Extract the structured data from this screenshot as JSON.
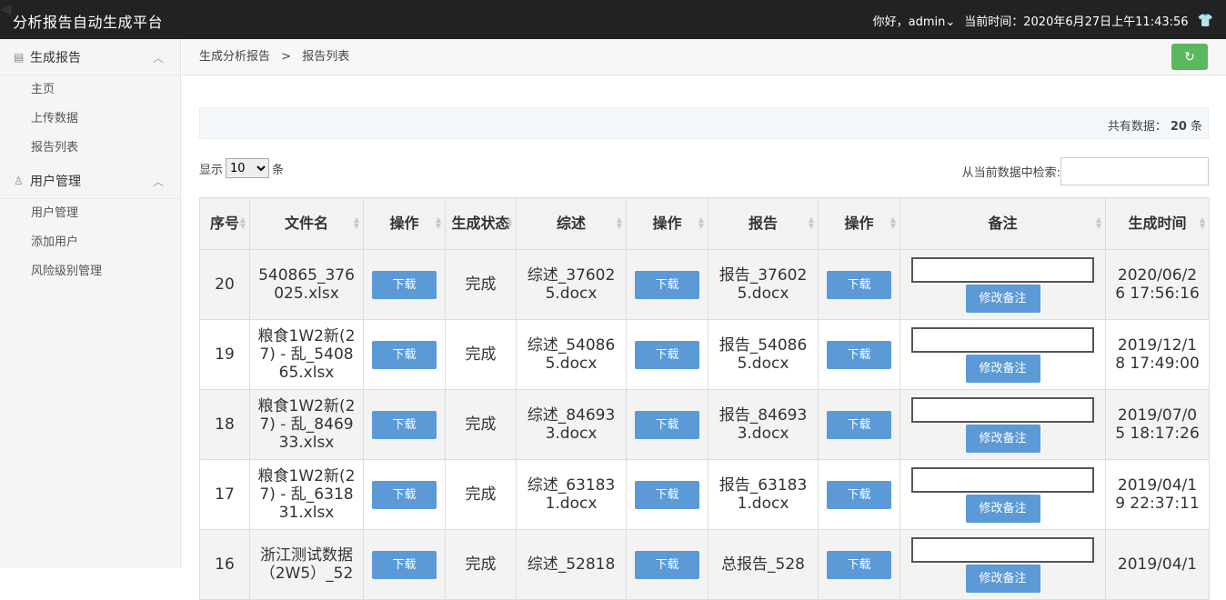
{
  "header": {
    "title": "分析报告自动生成平台",
    "greeting": "你好，admin",
    "current_time": "当前时间：2020年6月27日上午11:43:56"
  },
  "sidebar": {
    "groups": [
      {
        "label": "生成报告",
        "items": [
          "主页",
          "上传数据",
          "报告列表"
        ]
      },
      {
        "label": "用户管理",
        "items": [
          "用户管理",
          "添加用户",
          "风险级别管理"
        ]
      }
    ]
  },
  "breadcrumb": {
    "parent": "生成分析报告",
    "sep": ">",
    "current": "报告列表"
  },
  "summary": {
    "label": "共有数据：",
    "count": "20",
    "unit": "条"
  },
  "length_control": {
    "prefix": "显示",
    "value": "10",
    "suffix": "条"
  },
  "search": {
    "label": "从当前数据中检索:"
  },
  "table": {
    "headers": [
      "序号",
      "文件名",
      "操作",
      "生成状态",
      "综述",
      "操作",
      "报告",
      "操作",
      "备注",
      "生成时间"
    ],
    "download_label": "下载",
    "note_button_label": "修改备注",
    "rows": [
      {
        "id": "20",
        "file": "540865_376025.xlsx",
        "status": "完成",
        "summary": "综述_376025.docx",
        "report": "报告_376025.docx",
        "time": "2020/06/26 17:56:16"
      },
      {
        "id": "19",
        "file": "粮食1W2新(27) - 乱_540865.xlsx",
        "status": "完成",
        "summary": "综述_540865.docx",
        "report": "报告_540865.docx",
        "time": "2019/12/18 17:49:00"
      },
      {
        "id": "18",
        "file": "粮食1W2新(27) - 乱_846933.xlsx",
        "status": "完成",
        "summary": "综述_846933.docx",
        "report": "报告_846933.docx",
        "time": "2019/07/05 18:17:26"
      },
      {
        "id": "17",
        "file": "粮食1W2新(27) - 乱_631831.xlsx",
        "status": "完成",
        "summary": "综述_631831.docx",
        "report": "报告_631831.docx",
        "time": "2019/04/19 22:37:11"
      },
      {
        "id": "16",
        "file": "浙江测试数据（2W5）_52",
        "status": "完成",
        "summary": "综述_52818",
        "report": "总报告_528",
        "time": "2019/04/1"
      }
    ]
  },
  "colors": {
    "topbar": "#222222",
    "primary_button": "#5b9ad6",
    "refresh_button": "#5cb85c"
  },
  "icons": {
    "group_report": "report-icon",
    "group_user": "user-icon",
    "refresh": "refresh-icon",
    "shirt": "shirt-icon"
  }
}
